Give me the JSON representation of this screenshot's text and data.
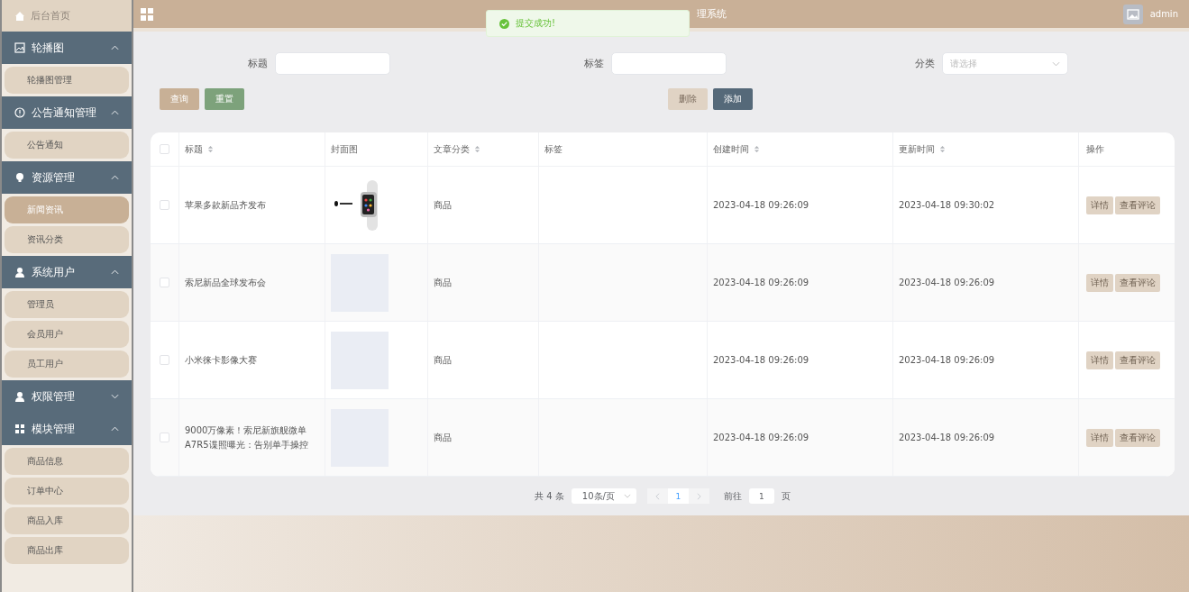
{
  "sidebar": {
    "home": {
      "label": "后台首页"
    },
    "groups": [
      {
        "label": "轮播图",
        "kind": "image",
        "expanded": true,
        "children": [
          {
            "label": "轮播图管理",
            "selected": false
          }
        ]
      },
      {
        "label": "公告通知管理",
        "kind": "info",
        "expanded": true,
        "children": [
          {
            "label": "公告通知",
            "selected": false
          }
        ]
      },
      {
        "label": "资源管理",
        "kind": "bulb",
        "expanded": true,
        "children": [
          {
            "label": "新闻资讯",
            "selected": true
          },
          {
            "label": "资讯分类",
            "selected": false
          }
        ]
      },
      {
        "label": "系统用户",
        "kind": "user",
        "expanded": true,
        "children": [
          {
            "label": "管理员",
            "selected": false
          },
          {
            "label": "会员用户",
            "selected": false
          },
          {
            "label": "员工用户",
            "selected": false
          }
        ]
      },
      {
        "label": "权限管理",
        "kind": "user",
        "expanded": false
      },
      {
        "label": "模块管理",
        "kind": "grid",
        "expanded": true,
        "children": [
          {
            "label": "商品信息",
            "selected": false
          },
          {
            "label": "订单中心",
            "selected": false
          },
          {
            "label": "商品入库",
            "selected": false
          },
          {
            "label": "商品出库",
            "selected": false
          }
        ]
      }
    ]
  },
  "header": {
    "title": "理系统",
    "user": "admin"
  },
  "toast": {
    "message": "提交成功!"
  },
  "filters": [
    {
      "label": "标题",
      "kind": "text"
    },
    {
      "label": "标签",
      "kind": "text"
    },
    {
      "label": "分类",
      "kind": "select",
      "placeholder": "请选择"
    }
  ],
  "buttons": [
    {
      "label": "查询",
      "kind": "search",
      "disabled": false
    },
    {
      "label": "重置",
      "kind": "reset",
      "disabled": false
    },
    {
      "label": "删除",
      "kind": "delete",
      "disabled": true
    },
    {
      "label": "添加",
      "kind": "add",
      "disabled": false
    }
  ],
  "table": {
    "select_all_checked": false,
    "columns": [
      {
        "label": "标题",
        "sortable": true
      },
      {
        "label": "封面图",
        "sortable": false
      },
      {
        "label": "文章分类",
        "sortable": true
      },
      {
        "label": "标签",
        "sortable": false
      },
      {
        "label": "创建时间",
        "sortable": true
      },
      {
        "label": "更新时间",
        "sortable": true
      },
      {
        "label": "操作",
        "sortable": false
      }
    ],
    "rows": [
      {
        "checked": false,
        "title": "苹果多款新品齐发布",
        "kind": "photo",
        "category": "商品",
        "created": "2023-04-18 09:26:09",
        "updated": "2023-04-18 09:30:02",
        "actions": [
          "详情",
          "查看评论"
        ]
      },
      {
        "checked": false,
        "title": "索尼新品全球发布会",
        "kind": "blank",
        "category": "商品",
        "created": "2023-04-18 09:26:09",
        "updated": "2023-04-18 09:26:09",
        "actions": [
          "详情",
          "查看评论"
        ]
      },
      {
        "checked": false,
        "title": "小米徕卡影像大赛",
        "kind": "blank",
        "category": "商品",
        "created": "2023-04-18 09:26:09",
        "updated": "2023-04-18 09:26:09",
        "actions": [
          "详情",
          "查看评论"
        ]
      },
      {
        "checked": false,
        "title": "9000万像素！索尼新旗舰微单A7R5谍照曝光：告别单手操控",
        "kind": "blank",
        "category": "商品",
        "created": "2023-04-18 09:26:09",
        "updated": "2023-04-18 09:26:09",
        "actions": [
          "详情",
          "查看评论"
        ]
      }
    ]
  },
  "pagination": {
    "total": "共 4 条",
    "page_size": "10条/页",
    "pages": [
      {
        "label": "1",
        "selected": true
      }
    ],
    "prev_disabled": true,
    "next_disabled": true,
    "goto_label": "前往",
    "goto_value": "1",
    "goto_suffix": "页"
  }
}
